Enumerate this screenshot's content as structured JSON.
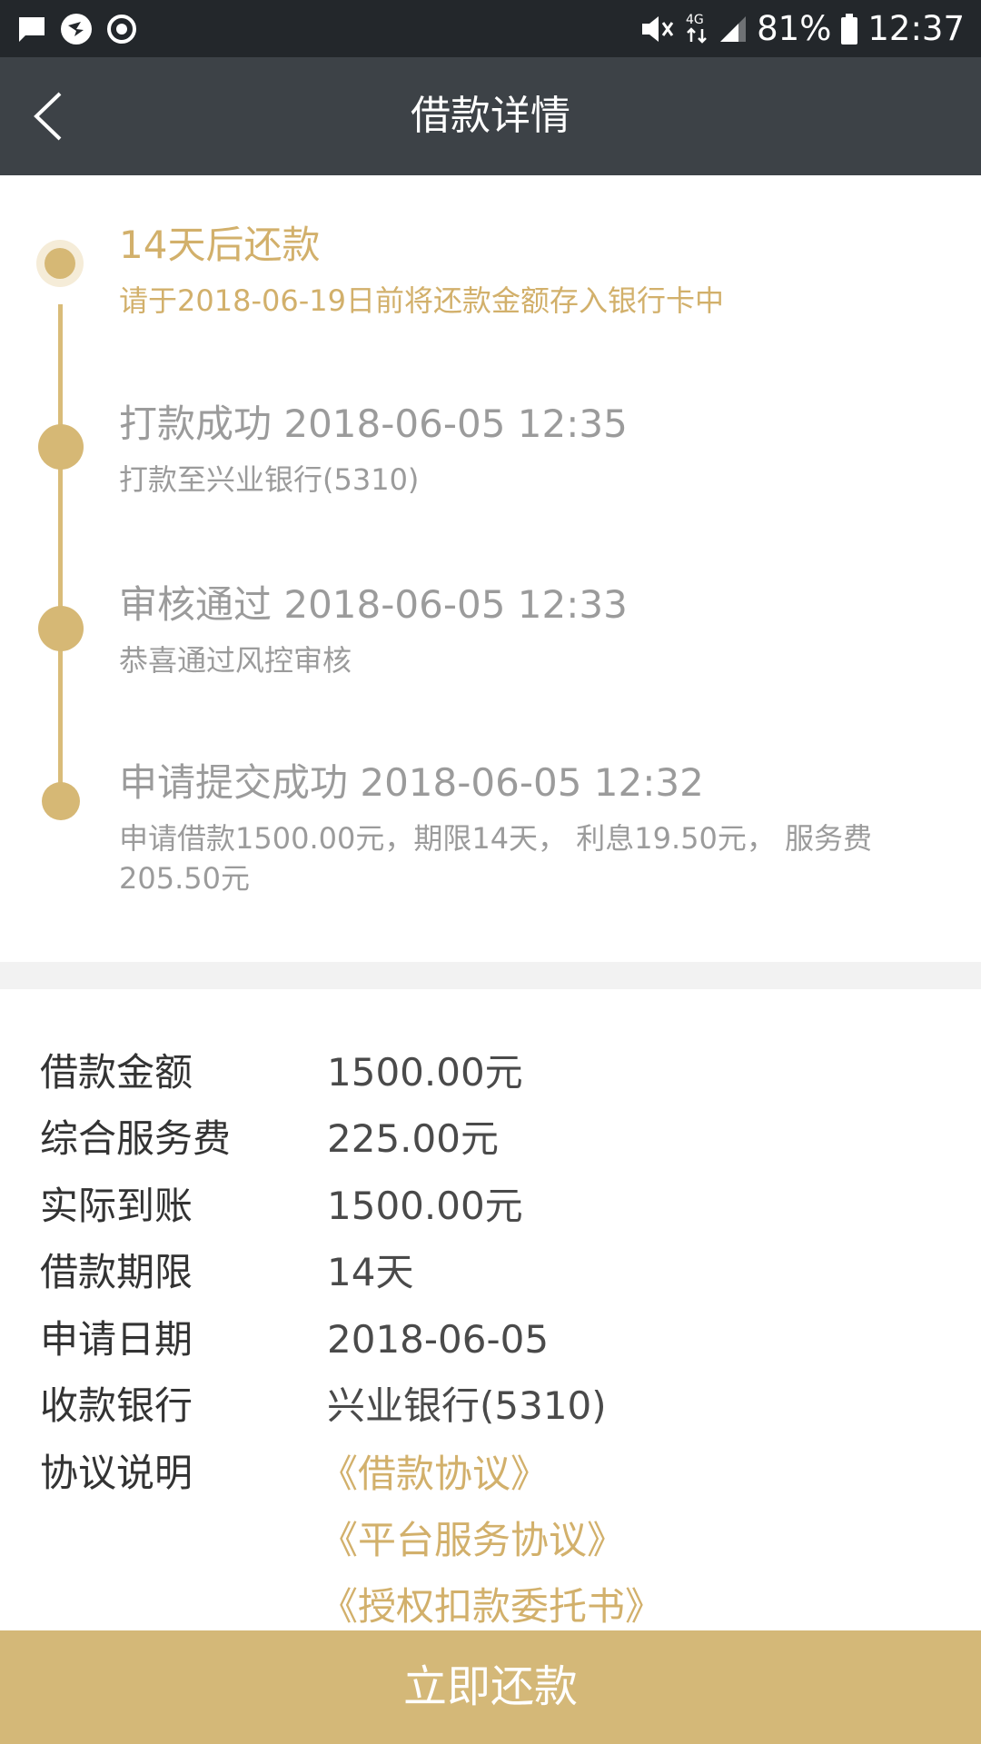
{
  "status_bar": {
    "battery": "81%",
    "time": "12:37",
    "network": "4G",
    "icons": [
      "message-icon",
      "bird-notification-icon",
      "sync-icon",
      "mute-icon",
      "data-arrows-icon",
      "signal-icon",
      "battery-icon"
    ]
  },
  "nav": {
    "title": "借款详情",
    "back_icon": "chevron-left-icon"
  },
  "timeline": [
    {
      "title": "14天后还款",
      "desc": "请于2018-06-19日前将还款金额存入银行卡中",
      "current": true
    },
    {
      "title": "打款成功 2018-06-05 12:35",
      "desc": "打款至兴业银行(5310)",
      "current": false
    },
    {
      "title": "审核通过 2018-06-05 12:33",
      "desc": "恭喜通过风控审核",
      "current": false
    },
    {
      "title": "申请提交成功 2018-06-05 12:32",
      "desc": "申请借款1500.00元，期限14天， 利息19.50元， 服务费205.50元",
      "current": false
    }
  ],
  "details": [
    {
      "label": "借款金额",
      "value": "1500.00元"
    },
    {
      "label": "综合服务费",
      "value": "225.00元"
    },
    {
      "label": "实际到账",
      "value": "1500.00元"
    },
    {
      "label": "借款期限",
      "value": "14天"
    },
    {
      "label": "申请日期",
      "value": "2018-06-05"
    },
    {
      "label": "收款银行",
      "value": "兴业银行(5310)"
    }
  ],
  "agreements": {
    "label": "协议说明",
    "links": [
      "《借款协议》",
      "《平台服务协议》",
      "《授权扣款委托书》"
    ]
  },
  "repay_button": "立即还款",
  "colors": {
    "accent": "#d4b878",
    "nav_bg": "#3d4247",
    "status_bg": "#23272b"
  }
}
